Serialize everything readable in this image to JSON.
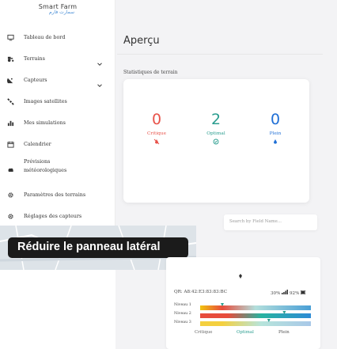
{
  "logo": {
    "main": "Smart Farm",
    "sub": "سمارت فارم"
  },
  "sidebar": {
    "items": [
      {
        "label": "Tableau de bord",
        "icon": "monitor-icon",
        "chevron": false
      },
      {
        "label": "Terrains",
        "icon": "tractor-icon",
        "chevron": true
      },
      {
        "label": "Capteurs",
        "icon": "satellite-dish-icon",
        "chevron": true
      },
      {
        "label": "Images satellites",
        "icon": "satellite-icon",
        "chevron": false
      },
      {
        "label": "Mes simulations",
        "icon": "chart-bar-icon",
        "chevron": false
      },
      {
        "label": "Calendrier",
        "icon": "calendar-icon",
        "chevron": false
      },
      {
        "label": "Prévisions météorologiques",
        "icon": "cloud-icon",
        "chevron": false
      },
      {
        "label": "Paramètres des terrains",
        "icon": "gear-icon",
        "chevron": false
      },
      {
        "label": "Réglages des capteurs",
        "icon": "gear-icon",
        "chevron": false
      }
    ]
  },
  "header": {
    "title": "Aperçu"
  },
  "stats": {
    "section_label": "Statistiques de terrain",
    "items": [
      {
        "value": "0",
        "label": "Critique",
        "color": "#e8534a",
        "icon": "no-water-icon"
      },
      {
        "value": "2",
        "label": "Optimal",
        "color": "#2a9d8f",
        "icon": "check-circle-icon"
      },
      {
        "value": "0",
        "label": "Plein",
        "color": "#1f6fd6",
        "icon": "water-drop-icon"
      }
    ]
  },
  "search": {
    "placeholder": "Search by Field Name..."
  },
  "tooltip": {
    "text": "Réduire le panneau latéral"
  },
  "sensor": {
    "qr": "QR: A8:42:E3:83:83:BC",
    "signal": "30%",
    "battery": "92%",
    "levels": [
      {
        "label": "Niveau 1",
        "fraction": 0.2
      },
      {
        "label": "Niveau 2",
        "fraction": 0.76
      },
      {
        "label": "Niveau 3",
        "fraction": 0.62
      }
    ],
    "legend": [
      {
        "label": "Critique",
        "color": "#666666"
      },
      {
        "label": "Optimal",
        "color": "#2a9d8f"
      },
      {
        "label": "Plein",
        "color": "#555555"
      }
    ]
  },
  "colors": {
    "critical": "#e8534a",
    "optimal": "#2a9d8f",
    "full": "#1f6fd6",
    "accent": "#4a8fd6"
  }
}
